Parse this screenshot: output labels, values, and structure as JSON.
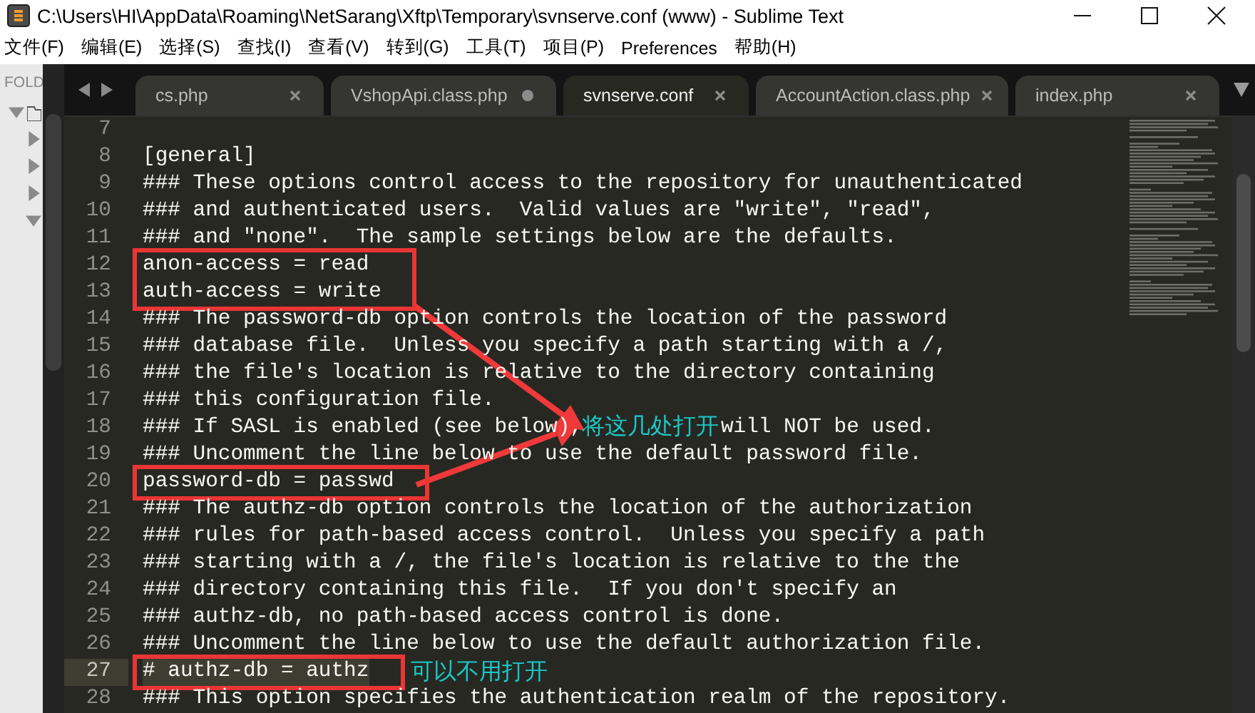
{
  "window": {
    "title": "C:\\Users\\HI\\AppData\\Roaming\\NetSarang\\Xftp\\Temporary\\svnserve.conf (www) - Sublime Text"
  },
  "menu": [
    "文件(F)",
    "编辑(E)",
    "选择(S)",
    "查找(I)",
    "查看(V)",
    "转到(G)",
    "工具(T)",
    "项目(P)",
    "Preferences",
    "帮助(H)"
  ],
  "sidebar": {
    "header": "FOLD",
    "tree": [
      {
        "expanded": true,
        "children": [
          {
            "expanded": false
          },
          {
            "expanded": false
          },
          {
            "expanded": false
          },
          {
            "expanded": true
          }
        ]
      }
    ]
  },
  "tabs": [
    {
      "label": "cs.php",
      "selected": false,
      "modified": false
    },
    {
      "label": "VshopApi.class.php",
      "selected": false,
      "modified": true
    },
    {
      "label": "svnserve.conf",
      "selected": true,
      "modified": false
    },
    {
      "label": "AccountAction.class.php",
      "selected": false,
      "modified": false
    },
    {
      "label": "index.php",
      "selected": false,
      "modified": false
    }
  ],
  "editor": {
    "lines": [
      {
        "number": "7",
        "marked": false,
        "current": false
      },
      {
        "number": "8",
        "text": "[general]",
        "marked": false,
        "current": false
      },
      {
        "number": "9",
        "text": "### These options control access to the repository for unauthenticated",
        "marked": false,
        "current": false
      },
      {
        "number": "10",
        "text": "### and authenticated users.  Valid values are \"write\", \"read\",",
        "marked": false,
        "current": false
      },
      {
        "number": "11",
        "text": "### and \"none\".  The sample settings below are the defaults.",
        "marked": false,
        "current": false
      },
      {
        "number": "12",
        "text": "anon-access = read",
        "marked": true,
        "current": false
      },
      {
        "number": "13",
        "text": "auth-access = write",
        "marked": true,
        "current": false
      },
      {
        "number": "14",
        "text": "### The password-db option controls the location of the password",
        "marked": false,
        "current": false
      },
      {
        "number": "15",
        "text": "### database file.  Unless you specify a path starting with a /,",
        "marked": false,
        "current": false
      },
      {
        "number": "16",
        "text": "### the file's location is relative to the directory containing",
        "marked": false,
        "current": false
      },
      {
        "number": "17",
        "text": "### this configuration file.",
        "marked": false,
        "current": false
      },
      {
        "number": "18",
        "segments": [
          "### If SASL is enabled (see below),",
          "will NOT be used."
        ],
        "marked": false,
        "current": false
      },
      {
        "number": "19",
        "text": "### Uncomment the line below to use the default password file.",
        "marked": false,
        "current": false
      },
      {
        "number": "20",
        "text": "password-db = passwd",
        "marked": true,
        "current": false
      },
      {
        "number": "21",
        "text": "### The authz-db option controls the location of the authorization",
        "marked": false,
        "current": false
      },
      {
        "number": "22",
        "text": "### rules for path-based access control.  Unless you specify a path",
        "marked": false,
        "current": false
      },
      {
        "number": "23",
        "text": "### starting with a /, the file's location is relative to the the",
        "marked": false,
        "current": false
      },
      {
        "number": "24",
        "text": "### directory containing this file.  If you don't specify an",
        "marked": false,
        "current": false
      },
      {
        "number": "25",
        "text": "### authz-db, no path-based access control is done.",
        "marked": false,
        "current": false
      },
      {
        "number": "26",
        "text": "### Uncomment the line below to use the default authorization file.",
        "marked": false,
        "current": false
      },
      {
        "number": "27",
        "text": "# authz-db = authz",
        "marked": true,
        "current": true
      },
      {
        "number": "28",
        "text": "### This option specifies the authentication realm of the repository.",
        "marked": false,
        "current": false
      }
    ]
  },
  "annotations": [
    {
      "text": "将这几处打开"
    },
    {
      "text": "可以不用打开"
    }
  ]
}
